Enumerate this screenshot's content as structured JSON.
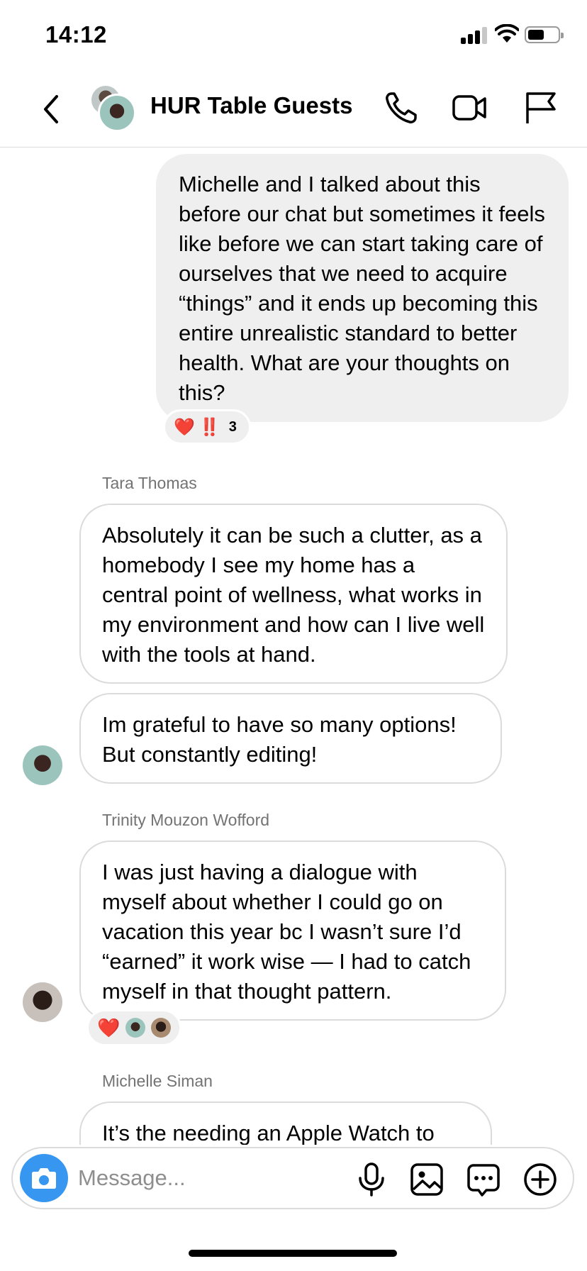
{
  "status_bar": {
    "time": "14:12",
    "battery_level": 0.55
  },
  "header": {
    "title": "HUR Table Guests",
    "icons": [
      "back-icon",
      "phone-icon",
      "video-icon",
      "flag-icon"
    ]
  },
  "messages": {
    "outgoing": {
      "text": "Michelle and I talked about this before our chat but sometimes it feels like before we can start taking care of ourselves that we need to acquire “things” and it ends up becoming this entire unrealistic standard to better health. What are your thoughts on this?",
      "reactions": {
        "emoji_1": "❤️",
        "emoji_2": "‼️",
        "count": "3"
      }
    },
    "tara": {
      "sender": "Tara Thomas",
      "message_1": "Absolutely it can be such a clutter, as a homebody I see my home has a central point of wellness, what works in my environment and how can I live well with the tools at hand.",
      "message_2": "Im grateful to have so many options! But constantly editing!"
    },
    "trinity": {
      "sender": "Trinity Mouzon Wofford",
      "message": "I was just having a dialogue with myself about whether I could go on vacation this year bc I wasn’t sure I’d “earned” it work wise — I had to catch myself in that thought pattern.",
      "reactions": {
        "emoji": "❤️"
      }
    },
    "michelle": {
      "sender": "Michelle Siman",
      "message": "It’s the needing an Apple Watch to"
    }
  },
  "composer": {
    "placeholder": "Message...",
    "icons": [
      "camera-icon",
      "microphone-icon",
      "gallery-icon",
      "sticker-icon",
      "plus-icon"
    ]
  },
  "colors": {
    "accent": "#3797f0",
    "bubble_gray": "#efefef",
    "border": "#dbdbdb",
    "sender_gray": "#737373",
    "reaction_red": "#ed1c24"
  }
}
